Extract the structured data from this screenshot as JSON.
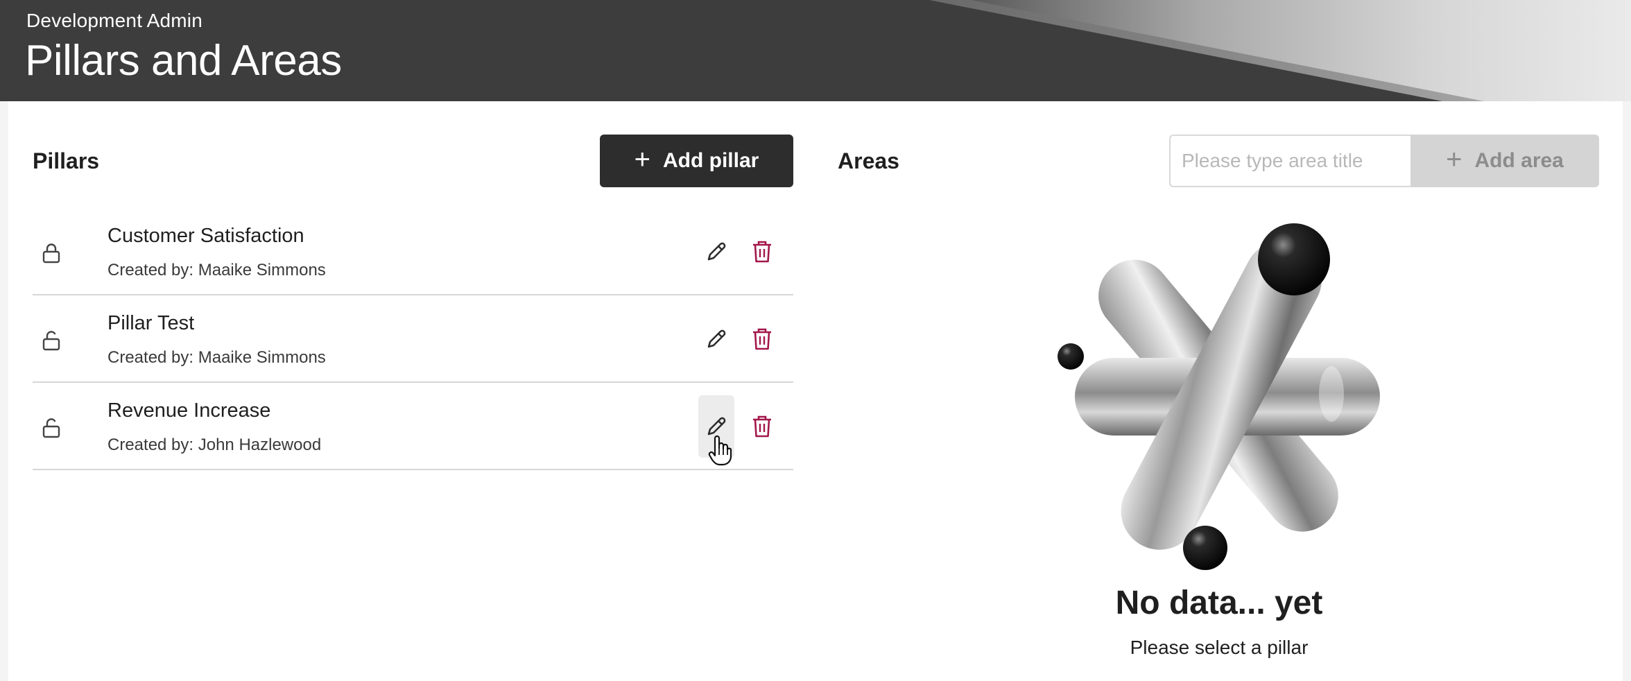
{
  "header": {
    "subtitle": "Development Admin",
    "title": "Pillars and Areas"
  },
  "pillars": {
    "title": "Pillars",
    "add_button_label": "Add pillar",
    "items": [
      {
        "name": "Customer Satisfaction",
        "creator": "Created by: Maaike Simmons",
        "lock_icon": "lock-closed-icon"
      },
      {
        "name": "Pillar Test",
        "creator": "Created by: Maaike Simmons",
        "lock_icon": "lock-open-icon"
      },
      {
        "name": "Revenue Increase",
        "creator": "Created by: John Hazlewood",
        "lock_icon": "lock-open-icon"
      }
    ]
  },
  "areas": {
    "title": "Areas",
    "input_placeholder": "Please type area title",
    "input_value": "",
    "add_button_label": "Add area",
    "empty_title": "No data... yet",
    "empty_subtitle": "Please select a pillar"
  },
  "colors": {
    "header_bg": "#3d3d3d",
    "primary_button": "#2d2d2d",
    "disabled_button": "#d4d4d4",
    "delete_icon": "#a3174a"
  }
}
